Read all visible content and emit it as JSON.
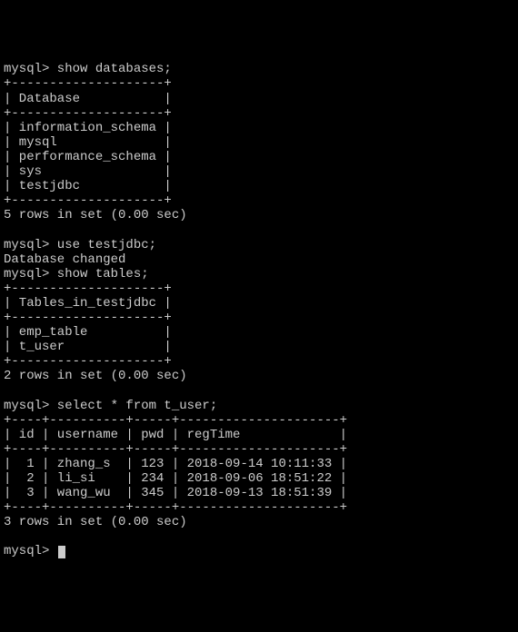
{
  "prompt_text": "mysql>",
  "commands": {
    "show_databases": "show databases;",
    "use_db": "use testjdbc;",
    "show_tables": "show tables;",
    "select": "select * from t_user;"
  },
  "msg_db_changed": "Database changed",
  "databases": {
    "header": "Database",
    "rows": [
      "information_schema",
      "mysql",
      "performance_schema",
      "sys",
      "testjdbc"
    ],
    "footer": "5 rows in set (0.00 sec)"
  },
  "tables": {
    "header": "Tables_in_testjdbc",
    "rows": [
      "emp_table",
      "t_user"
    ],
    "footer": "2 rows in set (0.00 sec)"
  },
  "t_user": {
    "cols": [
      "id",
      "username",
      "pwd",
      "regTime"
    ],
    "rows": [
      {
        "id": "1",
        "username": "zhang_s",
        "pwd": "123",
        "regTime": "2018-09-14 10:11:33"
      },
      {
        "id": "2",
        "username": "li_si",
        "pwd": "234",
        "regTime": "2018-09-06 18:51:22"
      },
      {
        "id": "3",
        "username": "wang_wu",
        "pwd": "345",
        "regTime": "2018-09-13 18:51:39"
      }
    ],
    "footer": "3 rows in set (0.00 sec)"
  }
}
